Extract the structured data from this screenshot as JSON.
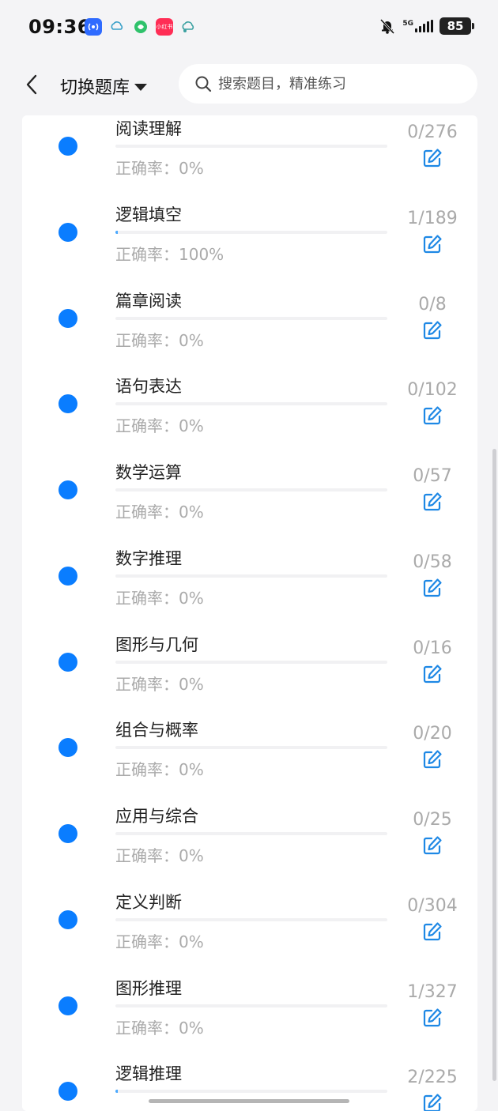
{
  "status_bar": {
    "time": "09:36",
    "network": "5G",
    "battery": "85",
    "app_icons": [
      "bluetooth-broadcast-icon",
      "cloud-icon",
      "green-app-icon",
      "xiaohongshu-icon",
      "cloud-icon"
    ],
    "app_label_red": "小红书"
  },
  "header": {
    "title": "切换题库",
    "search_placeholder": "搜索题目，精准练习"
  },
  "colors": {
    "accent": "#0a7dff",
    "progress": "#4aa8ff",
    "muted_text": "#aaaaaa"
  },
  "items": [
    {
      "name": "阅读理解",
      "accuracy": "正确率：0%",
      "count": "0/276",
      "progress": 0
    },
    {
      "name": "逻辑填空",
      "accuracy": "正确率：100%",
      "count": "1/189",
      "progress": 0.0053
    },
    {
      "name": "篇章阅读",
      "accuracy": "正确率：0%",
      "count": "0/8",
      "progress": 0
    },
    {
      "name": "语句表达",
      "accuracy": "正确率：0%",
      "count": "0/102",
      "progress": 0
    },
    {
      "name": "数学运算",
      "accuracy": "正确率：0%",
      "count": "0/57",
      "progress": 0
    },
    {
      "name": "数字推理",
      "accuracy": "正确率：0%",
      "count": "0/58",
      "progress": 0
    },
    {
      "name": "图形与几何",
      "accuracy": "正确率：0%",
      "count": "0/16",
      "progress": 0
    },
    {
      "name": "组合与概率",
      "accuracy": "正确率：0%",
      "count": "0/20",
      "progress": 0
    },
    {
      "name": "应用与综合",
      "accuracy": "正确率：0%",
      "count": "0/25",
      "progress": 0
    },
    {
      "name": "定义判断",
      "accuracy": "正确率：0%",
      "count": "0/304",
      "progress": 0
    },
    {
      "name": "图形推理",
      "accuracy": "正确率：0%",
      "count": "1/327",
      "progress": 0
    },
    {
      "name": "逻辑推理",
      "accuracy": "",
      "count": "2/225",
      "progress": 0.0089
    }
  ]
}
